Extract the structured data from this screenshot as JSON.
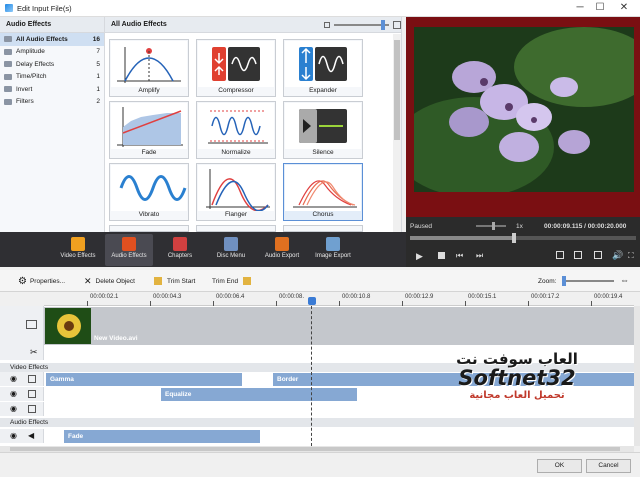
{
  "window": {
    "title": "Edit Input File(s)",
    "minimize": "─",
    "maximize": "☐",
    "close": "✕"
  },
  "categories": {
    "header": "Audio Effects",
    "items": [
      {
        "label": "All Audio Effects",
        "count": "16"
      },
      {
        "label": "Amplitude",
        "count": "7"
      },
      {
        "label": "Delay Effects",
        "count": "5"
      },
      {
        "label": "Time/Pitch",
        "count": "1"
      },
      {
        "label": "Invert",
        "count": "1"
      },
      {
        "label": "Filters",
        "count": "2"
      }
    ]
  },
  "effects": {
    "header": "All Audio Effects",
    "tiles": [
      {
        "label": "Amplify",
        "icon": "amplify-icon"
      },
      {
        "label": "Compressor",
        "icon": "compressor-icon"
      },
      {
        "label": "Expander",
        "icon": "expander-icon"
      },
      {
        "label": "Fade",
        "icon": "fade-icon"
      },
      {
        "label": "Normalize",
        "icon": "normalize-icon"
      },
      {
        "label": "Silence",
        "icon": "silence-icon"
      },
      {
        "label": "Vibrato",
        "icon": "vibrato-icon"
      },
      {
        "label": "Flanger",
        "icon": "flanger-icon"
      },
      {
        "label": "Chorus",
        "icon": "chorus-icon",
        "selected": true
      }
    ]
  },
  "player": {
    "status": "Paused",
    "speed": "1x",
    "time": "00:00:09.115 / 00:00:20.000"
  },
  "ribbon": {
    "items": [
      {
        "label": "Video Effects",
        "icon": "video-effects-icon",
        "color": "#f0a020"
      },
      {
        "label": "Audio Effects",
        "icon": "audio-effects-icon",
        "color": "#e05020",
        "selected": true
      },
      {
        "label": "Chapters",
        "icon": "chapters-icon",
        "color": "#d04040"
      },
      {
        "label": "Disc Menu",
        "icon": "disc-menu-icon",
        "color": "#7090c0"
      },
      {
        "label": "Audio Export",
        "icon": "audio-export-icon",
        "color": "#e07020"
      },
      {
        "label": "Image Export",
        "icon": "image-export-icon",
        "color": "#70a0d0"
      }
    ]
  },
  "toolbar": {
    "properties": "Properties...",
    "delete": "Delete Object",
    "trim_start": "Trim Start",
    "trim_end": "Trim End",
    "zoom": "Zoom:"
  },
  "timeline": {
    "ticks": [
      "00:00:02.1",
      "00:00:04.3",
      "00:00:06.4",
      "00:00:08.",
      "00:00:10.8",
      "00:00:12.9",
      "00:00:15.1",
      "00:00:17.2",
      "00:00:19.4"
    ],
    "clip_name": "New Video.avi",
    "video_effects_label": "Video Effects",
    "audio_effects_label": "Audio Effects",
    "bars": {
      "gamma": "Gamma",
      "border": "Border",
      "equalize": "Equalize",
      "fade": "Fade"
    }
  },
  "watermark": {
    "line1": "العاب سوفت نت",
    "line2": "Softnet32",
    "line3": "تحميل العاب مجانية"
  },
  "buttons": {
    "ok": "OK",
    "cancel": "Cancel"
  }
}
